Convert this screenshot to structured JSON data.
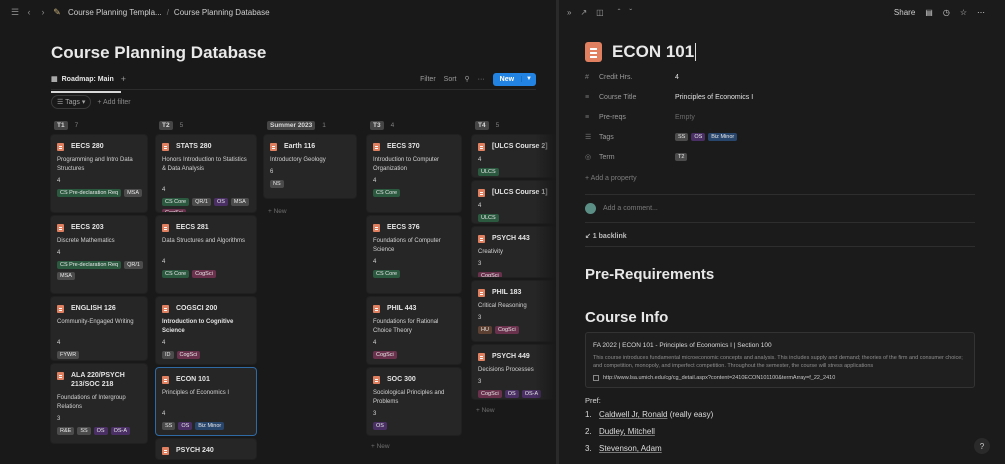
{
  "breadcrumb": {
    "parent": "Course Planning Templa...",
    "separator": "/",
    "current": "Course Planning Database"
  },
  "db": {
    "title": "Course Planning Database",
    "view_tab": "Roadmap: Main",
    "add_view": "+",
    "filter": "Filter",
    "sort": "Sort",
    "more": "···",
    "new_label": "New",
    "pill": "Tags",
    "add_filter": "+ Add filter"
  },
  "board": {
    "new_label": "+ New",
    "columns": [
      {
        "name": "T1",
        "count": "7",
        "cards": [
          {
            "code": "EECS 280",
            "title": "Programming and Intro Data Structures",
            "credits": "4",
            "tags": [
              {
                "t": "CS Pre-declaration Req",
                "c": "green"
              },
              {
                "t": "MSA",
                "c": "gray"
              }
            ]
          },
          {
            "code": "EECS 203",
            "title": "Discrete Mathematics",
            "credits": "4",
            "tags": [
              {
                "t": "CS Pre-declaration Req",
                "c": "green"
              },
              {
                "t": "QR/1",
                "c": "gray"
              },
              {
                "t": "MSA",
                "c": "gray"
              }
            ]
          },
          {
            "code": "ENGLISH 126",
            "title": "Community-Engaged Writing",
            "credits": "4",
            "tags": [
              {
                "t": "FYWR",
                "c": "gray"
              }
            ]
          },
          {
            "code": "ALA 220/PSYCH 213/SOC 218",
            "title": "Foundations of Intergroup Relations",
            "credits": "3",
            "tags": [
              {
                "t": "R&E",
                "c": "gray"
              },
              {
                "t": "SS",
                "c": "gray"
              },
              {
                "t": "OS",
                "c": "purple"
              },
              {
                "t": "OS-A",
                "c": "purple"
              }
            ]
          }
        ]
      },
      {
        "name": "T2",
        "count": "5",
        "cards": [
          {
            "code": "STATS 280",
            "title": "Honors Introduction to Statistics & Data Analysis",
            "credits": "4",
            "tags": [
              {
                "t": "CS Core",
                "c": "green"
              },
              {
                "t": "QR/1",
                "c": "gray"
              },
              {
                "t": "OS",
                "c": "purple"
              },
              {
                "t": "MSA",
                "c": "gray"
              },
              {
                "t": "CogSci",
                "c": "pink"
              }
            ]
          },
          {
            "code": "EECS 281",
            "title": "Data Structures and Algorithms",
            "credits": "4",
            "tags": [
              {
                "t": "CS Core",
                "c": "green"
              },
              {
                "t": "CogSci",
                "c": "pink"
              }
            ]
          },
          {
            "code": "COGSCI 200",
            "title": "Introduction to Cognitive Science",
            "credits": "4",
            "tags": [
              {
                "t": "ID",
                "c": "gray"
              },
              {
                "t": "CogSci",
                "c": "pink"
              }
            ]
          },
          {
            "code": "ECON 101",
            "title": "Principles of Economics I",
            "credits": "4",
            "tags": [
              {
                "t": "SS",
                "c": "gray"
              },
              {
                "t": "OS",
                "c": "purple"
              },
              {
                "t": "Biz Minor",
                "c": "blue"
              }
            ]
          },
          {
            "code": "PSYCH 240",
            "title": "",
            "credits": "",
            "tags": []
          }
        ]
      },
      {
        "name": "Summer 2023",
        "count": "1",
        "cards": [
          {
            "code": "Earth 116",
            "title": "Introductory Geology",
            "credits": "6",
            "tags": [
              {
                "t": "NS",
                "c": "gray"
              }
            ]
          }
        ]
      },
      {
        "name": "T3",
        "count": "4",
        "cards": [
          {
            "code": "EECS 370",
            "title": "Introduction to Computer Organization",
            "credits": "4",
            "tags": [
              {
                "t": "CS Core",
                "c": "green"
              }
            ]
          },
          {
            "code": "EECS 376",
            "title": "Foundations of Computer Science",
            "credits": "4",
            "tags": [
              {
                "t": "CS Core",
                "c": "green"
              }
            ]
          },
          {
            "code": "PHIL 443",
            "title": "Foundations for Rational Choice Theory",
            "credits": "4",
            "tags": [
              {
                "t": "CogSci",
                "c": "pink"
              }
            ]
          },
          {
            "code": "SOC 300",
            "title": "Sociological Principles and Problems",
            "credits": "3",
            "tags": [
              {
                "t": "OS",
                "c": "purple"
              }
            ]
          }
        ]
      },
      {
        "name": "T4",
        "count": "5",
        "cards": [
          {
            "code": "[ULCS Course 2]",
            "title": "",
            "credits": "4",
            "tags": [
              {
                "t": "ULCS",
                "c": "green"
              }
            ]
          },
          {
            "code": "[ULCS Course 1]",
            "title": "",
            "credits": "4",
            "tags": [
              {
                "t": "ULCS",
                "c": "green"
              }
            ]
          },
          {
            "code": "PSYCH 443",
            "title": "Creativity",
            "credits": "3",
            "tags": [
              {
                "t": "CogSci",
                "c": "pink"
              }
            ]
          },
          {
            "code": "PHIL 183",
            "title": "Critical Reasoning",
            "credits": "3",
            "tags": [
              {
                "t": "HU",
                "c": "brown"
              },
              {
                "t": "CogSci",
                "c": "pink"
              }
            ]
          },
          {
            "code": "PSYCH 449",
            "title": "Decisions Processes",
            "credits": "3",
            "tags": [
              {
                "t": "CogSci",
                "c": "pink"
              },
              {
                "t": "OS",
                "c": "purple"
              },
              {
                "t": "OS-A",
                "c": "purple"
              }
            ]
          }
        ]
      }
    ]
  },
  "page": {
    "title": "ECON 101",
    "toolbar": {
      "share": "Share"
    },
    "props": [
      {
        "icon": "#",
        "name": "Credit Hrs.",
        "value": "4"
      },
      {
        "icon": "≡",
        "name": "Course Title",
        "value": "Principles of Economics I"
      },
      {
        "icon": "≡",
        "name": "Pre-reqs",
        "value": "Empty"
      },
      {
        "icon": "☰",
        "name": "Tags",
        "tags": [
          {
            "t": "SS",
            "c": "gray"
          },
          {
            "t": "OS",
            "c": "purple"
          },
          {
            "t": "Biz Minor",
            "c": "blue"
          }
        ]
      },
      {
        "icon": "◎",
        "name": "Term",
        "tags": [
          {
            "t": "T2",
            "c": "gray"
          }
        ]
      }
    ],
    "add_property": "+ Add a property",
    "comment_placeholder": "Add a comment...",
    "backlink": "↙ 1 backlink",
    "h_prereq": "Pre-Requirements",
    "h_info": "Course Info",
    "info": {
      "title": "FA 2022 | ECON 101 - Principles of Economics I | Section 100",
      "desc": "This course introduces fundamental microeconomic concepts and analysis. This includes supply and demand; theories of the firm and consumer choice; and competition, monopoly, and imperfect competition. Throughout the semester, the course will stress applications",
      "url": "http://www.lsa.umich.edu/cg/cg_detail.aspx?content=2410ECON101100&termArray=f_22_2410"
    },
    "pref_label": "Pref:",
    "pref": [
      {
        "n": "1.",
        "name": "Caldwell Jr, Ronald",
        "note": " (really easy)"
      },
      {
        "n": "2.",
        "name": "Dudley, Mitchell",
        "note": ""
      },
      {
        "n": "3.",
        "name": "Stevenson, Adam",
        "note": ""
      }
    ],
    "help": "?"
  }
}
